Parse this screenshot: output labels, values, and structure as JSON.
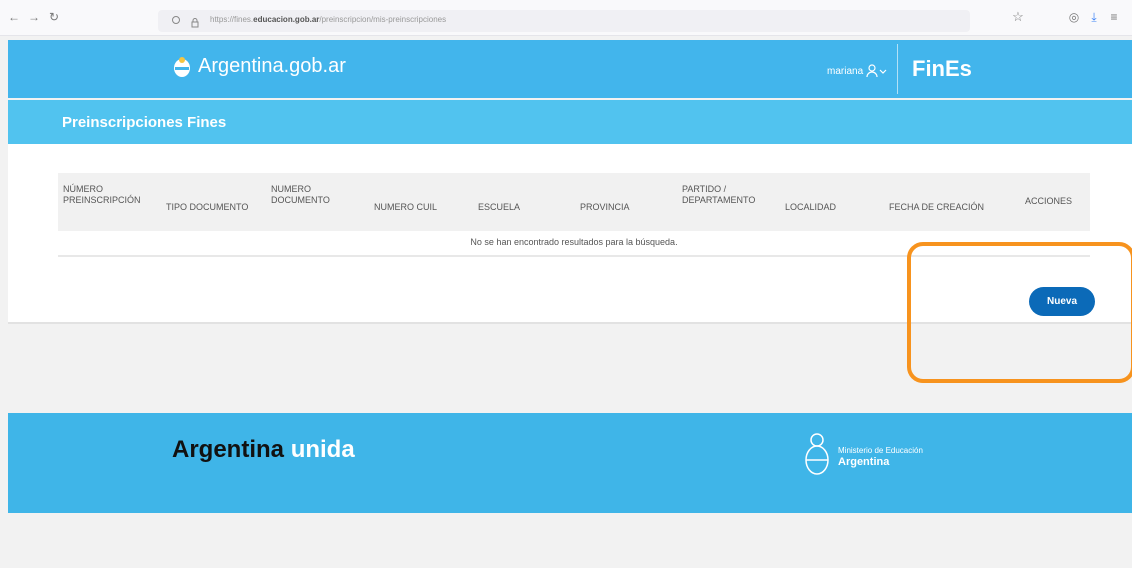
{
  "browser": {
    "url_prefix": "https://fines.",
    "url_domain": "educacion.gob.ar",
    "url_path": "/preinscripcion/mis-preinscripciones"
  },
  "header": {
    "logo_text": "Argentina.gob.ar",
    "user_name": "mariana",
    "app_name": "FinEs"
  },
  "page": {
    "title": "Preinscripciones Fines"
  },
  "table": {
    "columns": [
      [
        "NÚMERO",
        "PREINSCRIPCIÓN"
      ],
      [
        "TIPO DOCUMENTO"
      ],
      [
        "NUMERO",
        "DOCUMENTO"
      ],
      [
        "NUMERO CUIL"
      ],
      [
        "ESCUELA"
      ],
      [
        "PROVINCIA"
      ],
      [
        "PARTIDO /",
        "DEPARTAMENTO"
      ],
      [
        "LOCALIDAD"
      ],
      [
        "FECHA DE CREACIÓN"
      ],
      [
        "ACCIONES"
      ]
    ],
    "empty_message": "No se han encontrado resultados para la búsqueda."
  },
  "actions": {
    "new_label": "Nueva"
  },
  "footer": {
    "brand_main": "Argentina",
    "brand_accent": "unida",
    "ministry_line1": "Ministerio de Educación",
    "ministry_line2": "Argentina"
  },
  "colors": {
    "header_blue": "#42b5ec",
    "button_blue": "#0b6ab8",
    "highlight_orange": "#f7931e"
  }
}
